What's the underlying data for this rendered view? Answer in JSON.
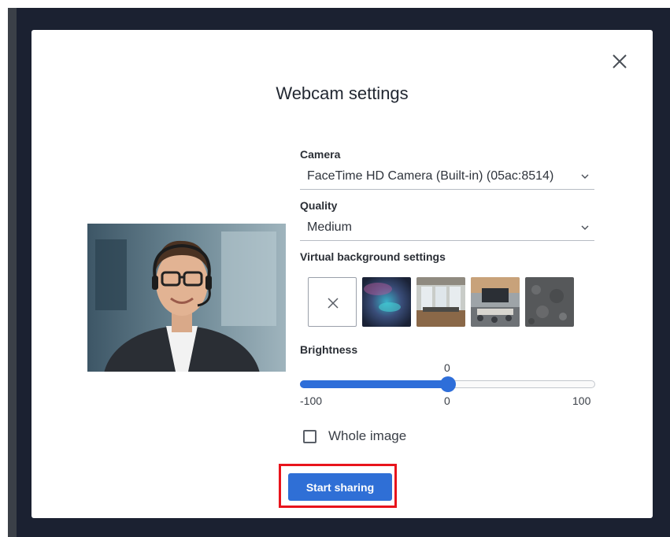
{
  "dialog": {
    "title": "Webcam settings",
    "close_icon": "close-icon"
  },
  "camera": {
    "label": "Camera",
    "value": "FaceTime HD Camera (Built-in) (05ac:8514)"
  },
  "quality": {
    "label": "Quality",
    "value": "Medium"
  },
  "virtual_background": {
    "label": "Virtual background settings",
    "options": [
      {
        "name": "none",
        "icon": "close-icon"
      },
      {
        "name": "aurora-sky"
      },
      {
        "name": "office-room"
      },
      {
        "name": "meeting-room"
      },
      {
        "name": "stone-texture"
      }
    ]
  },
  "brightness": {
    "label": "Brightness",
    "value": 0,
    "value_text": "0",
    "min": -100,
    "max": 100,
    "min_text": "-100",
    "mid_text": "0",
    "max_text": "100"
  },
  "whole_image": {
    "label": "Whole image",
    "checked": false
  },
  "actions": {
    "start_label": "Start sharing"
  },
  "colors": {
    "accent": "#2f6fd6",
    "highlight": "#e8141c",
    "backdrop": "#1b2131"
  }
}
